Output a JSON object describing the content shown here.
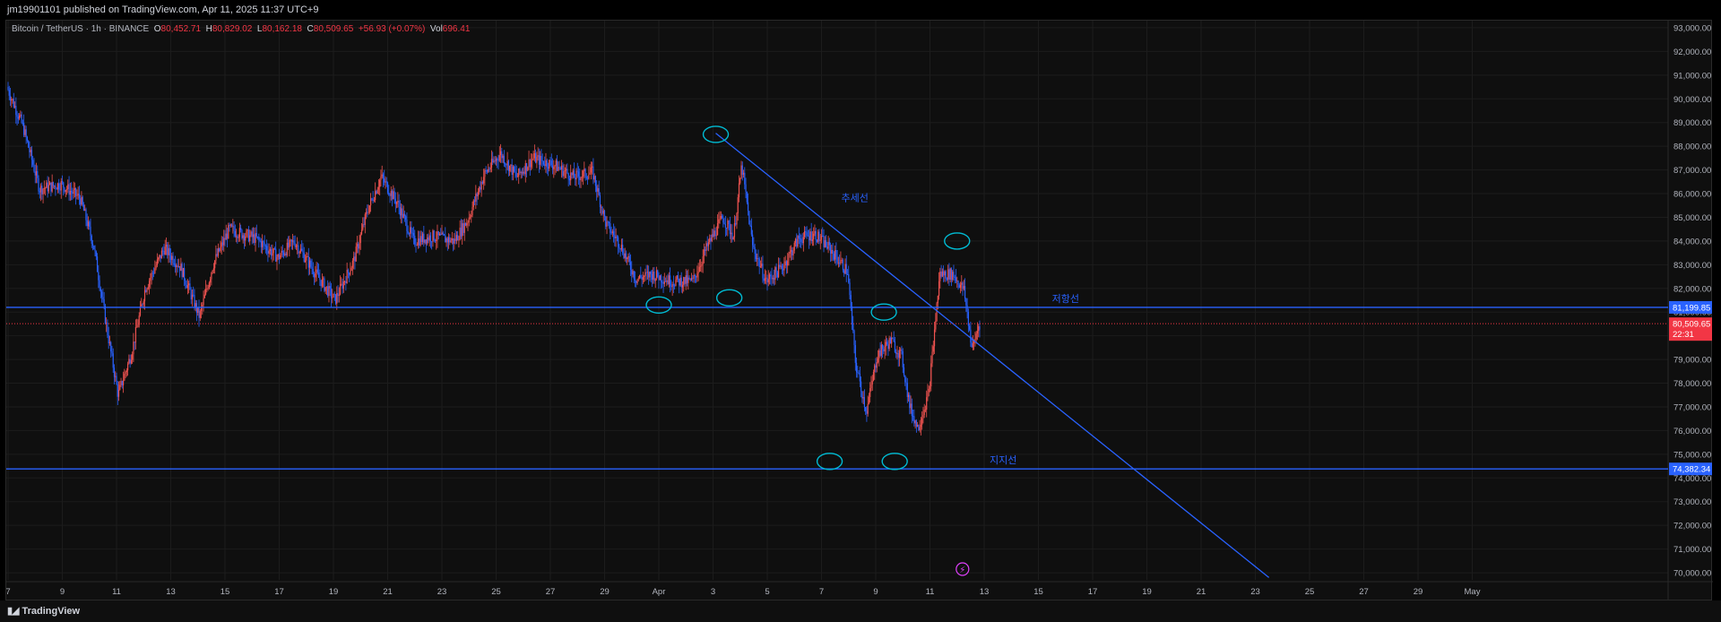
{
  "header": {
    "publish_line": "jm19901101 published on TradingView.com, Apr 11, 2025 11:37 UTC+9"
  },
  "legend": {
    "symbol": "Bitcoin / TetherUS · 1h · BINANCE",
    "o_label": "O",
    "o_value": "80,452.71",
    "h_label": "H",
    "h_value": "80,829.02",
    "l_label": "L",
    "l_value": "80,162.18",
    "c_label": "C",
    "c_value": "80,509.65",
    "change": "+56.93 (+0.07%)",
    "vol_label": "Vol",
    "vol_value": "696.41"
  },
  "footer": {
    "brand": "TradingView"
  },
  "colors": {
    "up": "#ef5350",
    "down": "#2962ff",
    "trendline": "#2962ff",
    "annotation": "#00bcd4",
    "price_label_bg": "#f23645",
    "level_label_bg": "#2962ff",
    "grid": "#1c1c1c",
    "icon": "#e040fb"
  },
  "chart_data": {
    "type": "candlestick",
    "symbol": "BTCUSDT",
    "interval": "1h",
    "exchange": "BINANCE",
    "ylim": [
      69700,
      93300
    ],
    "x_tick_labels": [
      "7",
      "9",
      "11",
      "13",
      "15",
      "17",
      "19",
      "21",
      "23",
      "25",
      "27",
      "29",
      "Apr",
      "3",
      "5",
      "7",
      "9",
      "11",
      "13",
      "15",
      "17",
      "19",
      "21",
      "23",
      "25",
      "27",
      "29",
      "May"
    ],
    "y_tick_labels": [
      "70,000.00",
      "71,000.00",
      "72,000.00",
      "73,000.00",
      "74,000.00",
      "75,000.00",
      "76,000.00",
      "77,000.00",
      "78,000.00",
      "79,000.00",
      "80,000.00",
      "81,000.00",
      "82,000.00",
      "83,000.00",
      "84,000.00",
      "85,000.00",
      "86,000.00",
      "87,000.00",
      "88,000.00",
      "89,000.00",
      "90,000.00",
      "91,000.00",
      "92,000.00",
      "93,000.00"
    ],
    "price_path": [
      {
        "d": 7.0,
        "p": 90500
      },
      {
        "d": 7.6,
        "p": 88800
      },
      {
        "d": 8.2,
        "p": 86200
      },
      {
        "d": 9.0,
        "p": 86400
      },
      {
        "d": 9.7,
        "p": 85800
      },
      {
        "d": 10.2,
        "p": 83800
      },
      {
        "d": 10.7,
        "p": 80200
      },
      {
        "d": 11.1,
        "p": 77500
      },
      {
        "d": 11.6,
        "p": 79300
      },
      {
        "d": 12.1,
        "p": 82000
      },
      {
        "d": 12.8,
        "p": 83700
      },
      {
        "d": 13.4,
        "p": 82900
      },
      {
        "d": 14.1,
        "p": 80800
      },
      {
        "d": 14.6,
        "p": 83000
      },
      {
        "d": 15.2,
        "p": 84500
      },
      {
        "d": 16.2,
        "p": 84100
      },
      {
        "d": 17.0,
        "p": 83300
      },
      {
        "d": 17.6,
        "p": 84000
      },
      {
        "d": 18.4,
        "p": 82600
      },
      {
        "d": 19.1,
        "p": 81500
      },
      {
        "d": 19.8,
        "p": 83200
      },
      {
        "d": 20.3,
        "p": 85300
      },
      {
        "d": 20.8,
        "p": 86700
      },
      {
        "d": 21.4,
        "p": 85600
      },
      {
        "d": 22.0,
        "p": 84000
      },
      {
        "d": 22.7,
        "p": 84200
      },
      {
        "d": 23.5,
        "p": 84000
      },
      {
        "d": 24.0,
        "p": 84900
      },
      {
        "d": 24.6,
        "p": 86800
      },
      {
        "d": 25.2,
        "p": 87700
      },
      {
        "d": 25.8,
        "p": 86700
      },
      {
        "d": 26.4,
        "p": 87500
      },
      {
        "d": 27.2,
        "p": 87200
      },
      {
        "d": 27.9,
        "p": 86700
      },
      {
        "d": 28.6,
        "p": 86900
      },
      {
        "d": 29.1,
        "p": 84700
      },
      {
        "d": 29.6,
        "p": 83900
      },
      {
        "d": 30.2,
        "p": 82400
      },
      {
        "d": 30.8,
        "p": 82600
      },
      {
        "d": 31.5,
        "p": 82300
      },
      {
        "d": 32.3,
        "p": 82300
      },
      {
        "d": 32.8,
        "p": 83700
      },
      {
        "d": 33.4,
        "p": 85000
      },
      {
        "d": 33.8,
        "p": 84200
      },
      {
        "d": 34.1,
        "p": 87200
      },
      {
        "d": 34.5,
        "p": 83800
      },
      {
        "d": 35.0,
        "p": 82300
      },
      {
        "d": 35.6,
        "p": 82900
      },
      {
        "d": 36.2,
        "p": 84100
      },
      {
        "d": 36.8,
        "p": 84300
      },
      {
        "d": 37.4,
        "p": 83600
      },
      {
        "d": 38.0,
        "p": 82700
      },
      {
        "d": 38.3,
        "p": 78800
      },
      {
        "d": 38.7,
        "p": 76800
      },
      {
        "d": 39.1,
        "p": 79200
      },
      {
        "d": 39.6,
        "p": 79800
      },
      {
        "d": 40.0,
        "p": 79100
      },
      {
        "d": 40.3,
        "p": 77000
      },
      {
        "d": 40.6,
        "p": 76100
      },
      {
        "d": 41.0,
        "p": 77600
      },
      {
        "d": 41.4,
        "p": 82600
      },
      {
        "d": 41.9,
        "p": 82600
      },
      {
        "d": 42.3,
        "p": 81900
      },
      {
        "d": 42.6,
        "p": 79400
      },
      {
        "d": 42.85,
        "p": 80509
      }
    ],
    "horizontal_levels": [
      {
        "price": 81199.85,
        "label": "81,199.85",
        "text": "저항선"
      },
      {
        "price": 74382.34,
        "label": "74,382.34",
        "text": "지지선"
      }
    ],
    "trend_line": {
      "from": {
        "d": 33.1,
        "p": 88550
      },
      "to": {
        "d": 53.5,
        "p": 69800
      },
      "text": "추세선"
    },
    "current_price": {
      "price": 80509.65,
      "label": "80,509.65",
      "countdown": "22:31"
    },
    "annotation_circles": [
      {
        "d": 33.1,
        "p": 88500
      },
      {
        "d": 31.0,
        "p": 81300
      },
      {
        "d": 33.6,
        "p": 81600
      },
      {
        "d": 39.3,
        "p": 81000
      },
      {
        "d": 42.0,
        "p": 84000
      },
      {
        "d": 37.3,
        "p": 74700
      },
      {
        "d": 39.7,
        "p": 74700
      }
    ]
  }
}
